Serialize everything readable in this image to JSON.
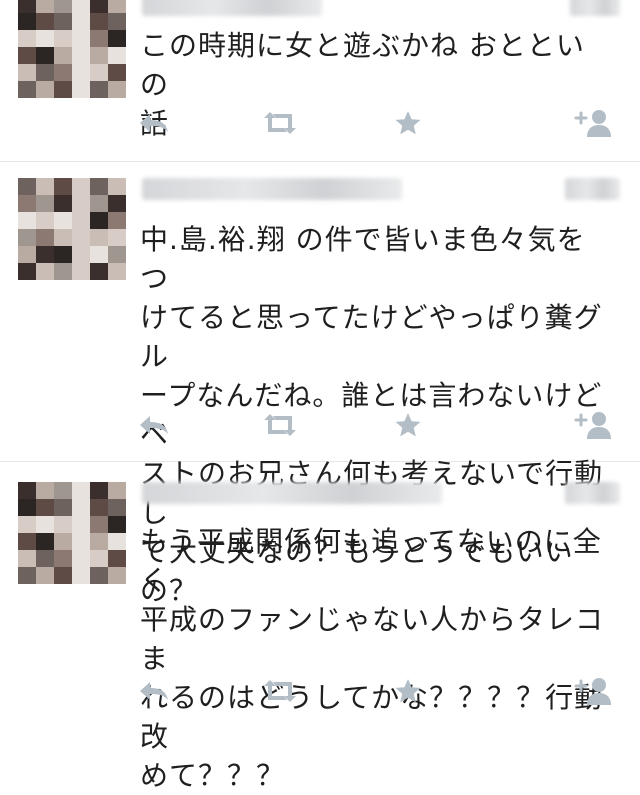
{
  "colors": {
    "icon": "#b3bdc6",
    "text": "#1f1f1f",
    "divider": "#e4e8ec"
  },
  "icons": [
    "reply-icon",
    "retweet-icon",
    "favorite-icon",
    "follow-icon"
  ],
  "tweets": [
    {
      "text": "この時期に女と遊ぶかね おとといの\n話"
    },
    {
      "text": "中.島.裕.翔 の件で皆いま色々気をつ\nけてると思ってたけどやっぱり糞グル\nープなんだね。誰とは言わないけどベ\nストのお兄さん何も考えないで行動し\nて大丈夫なの？もうどうでもいいの？"
    },
    {
      "text": "もう平成関係何も追ってないのに全く\n平成のファンじゃない人からタレコま\nれるのはどうしてかな？？？？行動改\nめて？？？"
    }
  ]
}
